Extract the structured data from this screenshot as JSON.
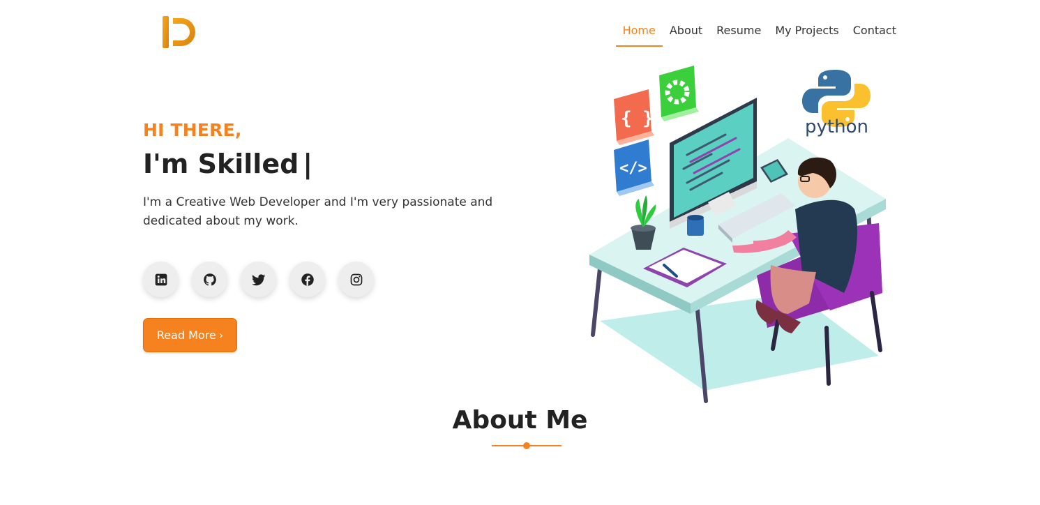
{
  "nav": {
    "items": [
      {
        "label": "Home",
        "active": true
      },
      {
        "label": "About",
        "active": false
      },
      {
        "label": "Resume",
        "active": false
      },
      {
        "label": "My Projects",
        "active": false
      },
      {
        "label": "Contact",
        "active": false
      }
    ]
  },
  "hero": {
    "greeting": "HI THERE,",
    "headline": "I'm Skilled",
    "cursor": "|",
    "tagline": "I'm a Creative Web Developer and I'm very passionate and dedicated about my work."
  },
  "socials": [
    {
      "name": "linkedin-icon"
    },
    {
      "name": "github-icon"
    },
    {
      "name": "twitter-icon"
    },
    {
      "name": "facebook-icon"
    },
    {
      "name": "instagram-icon"
    }
  ],
  "cta": {
    "label": "Read More",
    "chevron": "›"
  },
  "illustration": {
    "python_label": "python"
  },
  "about": {
    "title": "About Me"
  },
  "colors": {
    "accent": "#f5821f",
    "text": "#222222"
  }
}
